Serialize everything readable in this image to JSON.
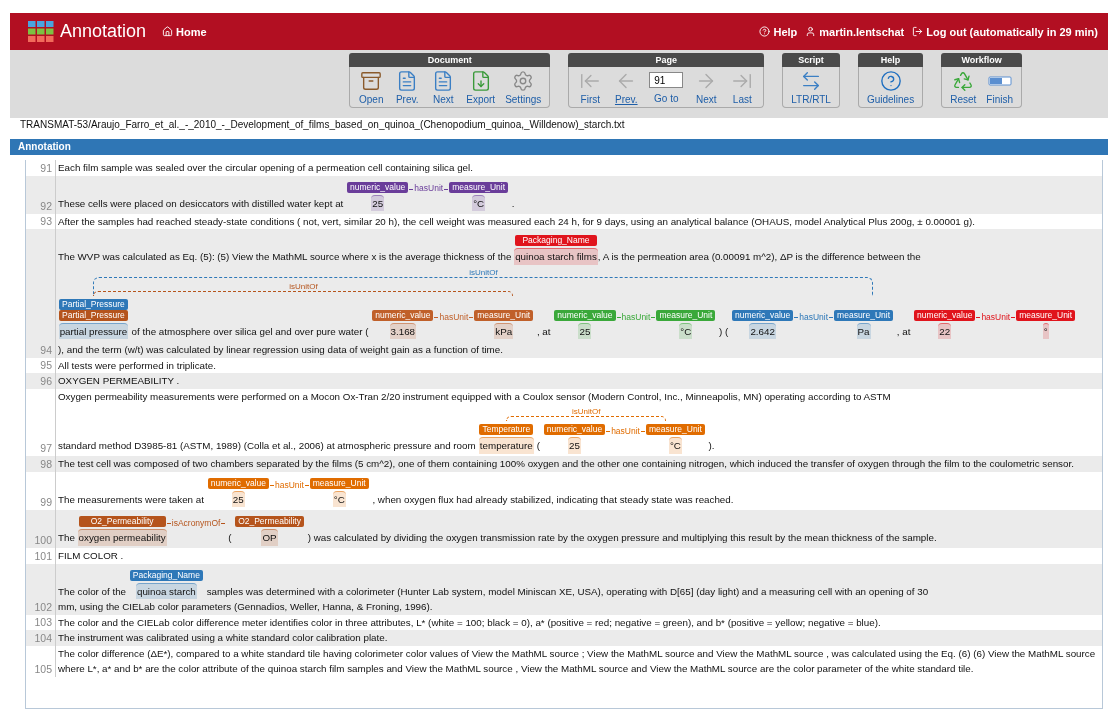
{
  "header": {
    "title": "Annotation",
    "home": "Home",
    "links": [
      {
        "kind": "help",
        "label": "Help"
      },
      {
        "kind": "user",
        "label": "martin.lentschat"
      },
      {
        "kind": "logout",
        "label": "Log out (automatically in 29 min)"
      }
    ]
  },
  "toolbar": [
    {
      "title": "Document",
      "buttons": [
        {
          "kind": "open",
          "label": "Open",
          "underlined": false
        },
        {
          "kind": "doc-prev",
          "label": "Prev.",
          "underlined": false
        },
        {
          "kind": "doc-next",
          "label": "Next",
          "underlined": false
        },
        {
          "kind": "export",
          "label": "Export",
          "underlined": false
        },
        {
          "kind": "settings",
          "label": "Settings",
          "underlined": false
        }
      ]
    },
    {
      "title": "Page",
      "buttons": [
        {
          "kind": "first",
          "label": "First",
          "underlined": false
        },
        {
          "kind": "prev",
          "label": "Prev.",
          "underlined": true
        },
        {
          "kind": "goto",
          "label": "Go to",
          "value": "91",
          "underlined": false
        },
        {
          "kind": "next",
          "label": "Next",
          "underlined": false
        },
        {
          "kind": "last",
          "label": "Last",
          "underlined": false
        }
      ]
    },
    {
      "title": "Script",
      "buttons": [
        {
          "kind": "ltr",
          "label": "LTR/RTL",
          "underlined": false
        }
      ]
    },
    {
      "title": "Help",
      "buttons": [
        {
          "kind": "guidelines",
          "label": "Guidelines",
          "underlined": false
        }
      ]
    },
    {
      "title": "Workflow",
      "buttons": [
        {
          "kind": "reset",
          "label": "Reset",
          "underlined": false
        },
        {
          "kind": "finish",
          "label": "Finish",
          "underlined": false
        }
      ]
    }
  ],
  "file_path": "TRANSMAT-53/Araujo_Farro_et_al._-_2010_-_Development_of_films_based_on_quinoa_(Chenopodium_quinoa,_Willdenow)_starch.txt",
  "panel": {
    "title": "Annotation",
    "sentences": [
      {
        "number": "91",
        "segments": [
          {
            "kind": "text",
            "text": "Each film sample was sealed over the circular opening of a permeation cell containing silica gel."
          }
        ]
      },
      {
        "number": "92",
        "segments": [
          {
            "kind": "text",
            "text": "These cells were placed on desiccators with distilled water kept at "
          },
          {
            "kind": "span",
            "text": "25",
            "labels": [
              {
                "label": "numeric_value",
                "color": "#6a3d9a"
              }
            ]
          },
          {
            "kind": "relation",
            "label": "hasUnit",
            "color": "#6a3d9a"
          },
          {
            "kind": "span",
            "text": "°C",
            "labels": [
              {
                "label": "measure_Unit",
                "color": "#6a3d9a"
              }
            ]
          },
          {
            "kind": "text",
            "text": " ."
          }
        ]
      },
      {
        "number": "93",
        "segments": [
          {
            "kind": "text",
            "text": "After the samples had reached steady-state conditions ( not, vert, similar 20 h), the cell weight was measured each 24 h, for 9 days, using an analytical balance (OHAUS, model Analytical Plus 200g, ± 0.00001 g)."
          }
        ]
      },
      {
        "number": "94",
        "segments": [
          {
            "kind": "text",
            "text": "The WVP was calculated as Eq. (5): (5) View the MathML source where x is the average thickness of the "
          },
          {
            "kind": "span",
            "text": "quinoa starch films",
            "labels": [
              {
                "label": "Packaging_Name",
                "color": "#e0141c"
              }
            ]
          },
          {
            "kind": "text",
            "text": ", A is the permeation area (0.00091 m^2), ΔP is the difference between the "
          },
          {
            "kind": "break"
          },
          {
            "kind": "span",
            "text": "partial pressure",
            "labels": [
              {
                "label": "Partial_Pressure",
                "color": "#2e78b8"
              },
              {
                "label": "Partial_Pressure",
                "color": "#b5541c"
              }
            ],
            "arcs": [
              {
                "label": "isUnitOf",
                "color": "#2e78b8"
              },
              {
                "label": "isUnitOf",
                "color": "#b5541c"
              }
            ]
          },
          {
            "kind": "text",
            "text": " of the atmosphere over silica gel and over pure water ( "
          },
          {
            "kind": "span",
            "text": "3.168",
            "labels": [
              {
                "label": "numeric_value",
                "color": "#c0602a"
              }
            ]
          },
          {
            "kind": "relation",
            "label": "hasUnit",
            "color": "#c0602a"
          },
          {
            "kind": "span",
            "text": "kPa",
            "labels": [
              {
                "label": "measure_Unit",
                "color": "#c0602a"
              }
            ]
          },
          {
            "kind": "text",
            "text": " , at "
          },
          {
            "kind": "span",
            "text": "25",
            "labels": [
              {
                "label": "numeric_value",
                "color": "#3aa83a"
              }
            ]
          },
          {
            "kind": "relation",
            "label": "hasUnit",
            "color": "#3aa83a"
          },
          {
            "kind": "span",
            "text": "°C",
            "labels": [
              {
                "label": "measure_Unit",
                "color": "#3aa83a"
              }
            ]
          },
          {
            "kind": "text",
            "text": " ) ( "
          },
          {
            "kind": "span",
            "text": "2.642",
            "labels": [
              {
                "label": "numeric_value",
                "color": "#2e78b8"
              }
            ]
          },
          {
            "kind": "relation",
            "label": "hasUnit",
            "color": "#2e78b8"
          },
          {
            "kind": "span",
            "text": "Pa",
            "labels": [
              {
                "label": "measure_Unit",
                "color": "#2e78b8"
              }
            ]
          },
          {
            "kind": "text",
            "text": " , at "
          },
          {
            "kind": "span",
            "text": "22",
            "labels": [
              {
                "label": "numeric_value",
                "color": "#e0141c"
              }
            ]
          },
          {
            "kind": "relation",
            "label": "hasUnit",
            "color": "#e0141c"
          },
          {
            "kind": "span",
            "text": "°",
            "labels": [
              {
                "label": "measure_Unit",
                "color": "#e0141c"
              }
            ]
          },
          {
            "kind": "break"
          },
          {
            "kind": "text",
            "text": " ), and the term (w/t) was calculated by linear regression using data of weight gain as a function of time."
          }
        ]
      },
      {
        "number": "95",
        "segments": [
          {
            "kind": "text",
            "text": "All tests were performed in triplicate."
          }
        ]
      },
      {
        "number": "96",
        "segments": [
          {
            "kind": "text",
            "text": "OXYGEN PERMEABILITY ."
          }
        ]
      },
      {
        "number": "97",
        "segments": [
          {
            "kind": "text",
            "text": "Oxygen permeability measurements were performed on a Mocon Ox-Tran 2/20 instrument equipped with a Coulox sensor (Modern Control, Inc., Minneapolis, MN) operating according to ASTM"
          },
          {
            "kind": "break"
          },
          {
            "kind": "text",
            "text": "standard method D3985-81 (ASTM, 1989) (Colla et al., 2006) at atmospheric pressure and room "
          },
          {
            "kind": "span",
            "text": "temperature",
            "labels": [
              {
                "label": "Temperature",
                "color": "#e06c00"
              }
            ],
            "arcs": [
              {
                "label": "isUnitOf",
                "color": "#e06c00"
              }
            ]
          },
          {
            "kind": "text",
            "text": " ( "
          },
          {
            "kind": "span",
            "text": "25",
            "labels": [
              {
                "label": "numeric_value",
                "color": "#e06c00"
              }
            ]
          },
          {
            "kind": "relation",
            "label": "hasUnit",
            "color": "#e06c00"
          },
          {
            "kind": "span",
            "text": "°C",
            "labels": [
              {
                "label": "measure_Unit",
                "color": "#e06c00"
              }
            ]
          },
          {
            "kind": "text",
            "text": " )."
          }
        ]
      },
      {
        "number": "98",
        "segments": [
          {
            "kind": "text",
            "text": "The test cell was composed of two chambers separated by the films (5 cm^2), one of them containing 100% oxygen and the other one containing nitrogen, which induced the transfer of oxygen through the film to the coulometric sensor."
          }
        ]
      },
      {
        "number": "99",
        "segments": [
          {
            "kind": "text",
            "text": "The measurements were taken at "
          },
          {
            "kind": "span",
            "text": "25",
            "labels": [
              {
                "label": "numeric_value",
                "color": "#e06c00"
              }
            ]
          },
          {
            "kind": "relation",
            "label": "hasUnit",
            "color": "#e06c00"
          },
          {
            "kind": "span",
            "text": "°C",
            "labels": [
              {
                "label": "measure_Unit",
                "color": "#e06c00"
              }
            ]
          },
          {
            "kind": "text",
            "text": " , when oxygen flux had already stabilized, indicating that steady state was reached."
          }
        ]
      },
      {
        "number": "100",
        "segments": [
          {
            "kind": "text",
            "text": "The "
          },
          {
            "kind": "span",
            "text": "oxygen permeability",
            "labels": [
              {
                "label": "O2_Permeability",
                "color": "#b5541c"
              }
            ]
          },
          {
            "kind": "relation",
            "label": "isAcronymOf",
            "color": "#b5541c"
          },
          {
            "kind": "text",
            "text": " ( "
          },
          {
            "kind": "span",
            "text": "OP",
            "labels": [
              {
                "label": "O2_Permeability",
                "color": "#b5541c"
              }
            ]
          },
          {
            "kind": "text",
            "text": " ) was calculated by dividing the oxygen transmission rate by the oxygen pressure and multiplying this result by the mean thickness of the sample."
          }
        ]
      },
      {
        "number": "101",
        "segments": [
          {
            "kind": "text",
            "text": "FILM COLOR ."
          }
        ]
      },
      {
        "number": "102",
        "segments": [
          {
            "kind": "text",
            "text": "The color of the "
          },
          {
            "kind": "span",
            "text": "quinoa starch",
            "labels": [
              {
                "label": "Packaging_Name",
                "color": "#2e78b8"
              }
            ]
          },
          {
            "kind": "text",
            "text": " samples was determined with a colorimeter (Hunter Lab system, model Miniscan XE, USA), operating with D[65] (day light) and a measuring cell with an opening of 30"
          },
          {
            "kind": "break"
          },
          {
            "kind": "text",
            "text": "mm, using the CIELab color parameters (Gennadios, Weller, Hanna, & Froning, 1996)."
          }
        ]
      },
      {
        "number": "103",
        "segments": [
          {
            "kind": "text",
            "text": "The color and the CIELab color difference meter identifies color in three attributes, L* (white = 100; black = 0), a* (positive = red; negative = green), and b* (positive = yellow; negative = blue)."
          }
        ]
      },
      {
        "number": "104",
        "segments": [
          {
            "kind": "text",
            "text": "The instrument was calibrated using a white standard color calibration plate."
          }
        ]
      },
      {
        "number": "105",
        "segments": [
          {
            "kind": "text",
            "text": "The color difference (ΔE*), compared to a white standard tile having colorimeter color values of View the MathML source ; View the MathML source and View the MathML source , was calculated using the Eq. (6) (6) View the MathML source where L*, a* and b* are the color attribute of the quinoa starch film samples and View the MathML source , View the MathML source and View the MathML source are the color parameter of the white standard tile."
          }
        ]
      }
    ]
  }
}
